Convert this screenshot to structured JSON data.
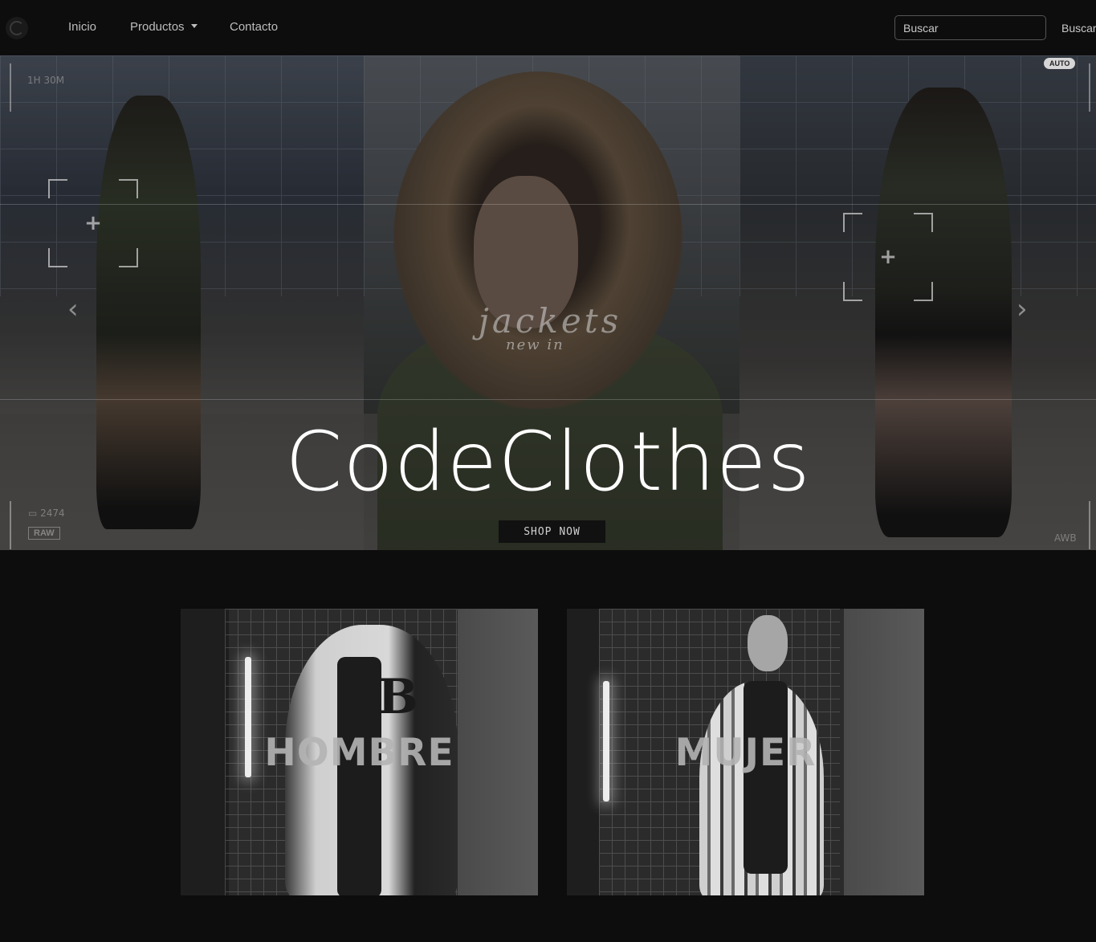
{
  "navbar": {
    "brand_icon": "codeclothes-logo-icon",
    "links": [
      {
        "label": "Inicio"
      },
      {
        "label": "Productos",
        "icon": "caret-down-icon"
      },
      {
        "label": "Contacto"
      }
    ],
    "search": {
      "placeholder": "Buscar",
      "value": "",
      "button_label": "Buscar"
    }
  },
  "hero": {
    "title": "CodeClothes",
    "banner_text": "jackets",
    "banner_subtext": "new in",
    "cta_label": "SHOP NOW",
    "camera_overlay": {
      "top_left": "1H 30M",
      "shots": "2474",
      "format": "RAW",
      "mode": "AUTO",
      "white_balance": "AWB"
    }
  },
  "categories": [
    {
      "label": "HOMBRE"
    },
    {
      "label": "MUJER"
    }
  ],
  "colors": {
    "background": "#0d0d0d",
    "title": "#ffffff",
    "nav_text": "#bdbdbd"
  }
}
